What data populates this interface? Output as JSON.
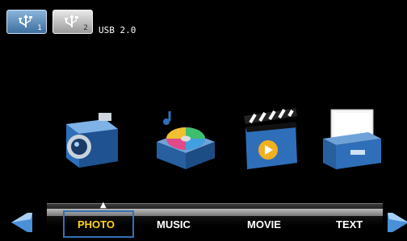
{
  "header": {
    "usb_label": "USB 2.0",
    "ports": [
      {
        "number": "1",
        "icon": "usb-icon",
        "state": "selected"
      },
      {
        "number": "2",
        "icon": "usb-icon",
        "state": "unselected"
      }
    ]
  },
  "media_icons": [
    "camera-icon",
    "music-disc-icon",
    "clapperboard-icon",
    "file-cabinet-icon"
  ],
  "tabs": [
    {
      "label": "PHOTO",
      "selected": true
    },
    {
      "label": "MUSIC",
      "selected": false
    },
    {
      "label": "MOVIE",
      "selected": false
    },
    {
      "label": "TEXT",
      "selected": false
    }
  ],
  "colors": {
    "accent": "#ffd21a",
    "selection": "#3570b5",
    "arrow": "#4a90d9"
  }
}
